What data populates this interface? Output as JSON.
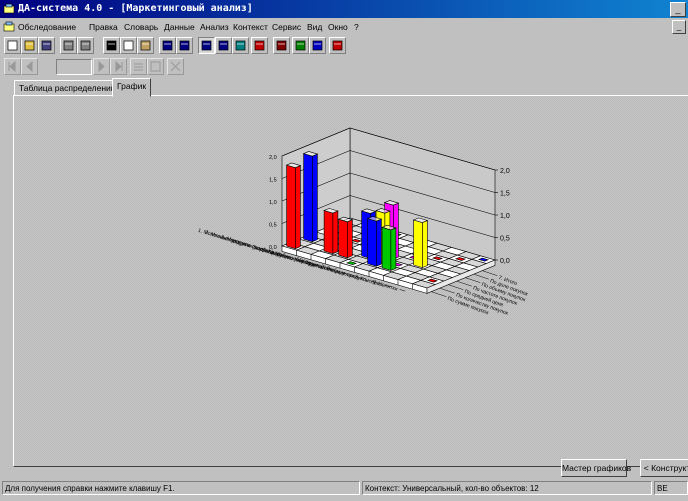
{
  "window": {
    "title": "ДА-система 4.0 - [Маркетинговый анализ]",
    "min_glyph": "_",
    "mdi_min_glyph": "_",
    "mdi_restore_glyph": "▫"
  },
  "menu": [
    "Обследование",
    "Правка",
    "Словарь",
    "Данные",
    "Анализ",
    "Контекст",
    "Сервис",
    "Вид",
    "Окно",
    "?"
  ],
  "toolbar_icons": [
    "new-icon",
    "open-icon",
    "save-icon",
    "print-icon",
    "print-preview-icon",
    "cut-icon",
    "copy-icon",
    "paste-icon",
    "undo-icon",
    "redo-icon",
    "table-icon",
    "grid-icon",
    "refresh-icon",
    "chart-icon",
    "link-icon",
    "excel-icon",
    "word-icon",
    "export-icon"
  ],
  "nav_icons": [
    "first-record-icon",
    "prev-record-icon",
    "next-record-icon",
    "last-record-icon",
    "list-icon",
    "edit-icon",
    "delete-icon"
  ],
  "tabs": [
    "Таблица распределений",
    "График"
  ],
  "buttons": {
    "chart_master": "Мастер графиков",
    "constructor": "< Конструкт"
  },
  "status": {
    "help": "Для получения справки нажмите клавишу F1.",
    "context": "Контекст: Универсальный, кол-во объектов: 12",
    "right": "ВЕ"
  },
  "colors": {
    "red": "#ff0000",
    "blue": "#0000ff",
    "green": "#00c800",
    "yellow": "#ffff00",
    "magenta": "#ff00ff",
    "cyan": "#00ffff"
  },
  "chart_data": {
    "type": "bar",
    "title": "",
    "z_axis_ticks": [
      "2,0",
      "1,5",
      "1,0",
      "0,5",
      "0,0"
    ],
    "left_axis_ticks": [
      "2,0",
      "1,5",
      "1,0",
      "0,5",
      "0,0"
    ],
    "zlim": [
      0,
      2
    ],
    "categories": [
      "1. Молочные продукты (сыр, кефир)",
      "2. Мясные продукты (колбаса, сосиски)",
      "3. Молочные продукты (масло, творог)",
      "4. Хлебобулочные изделия",
      "5. Фрукты, овощи",
      "6. Кондитерские изделия",
      "7. Рыбные продукты",
      "8. Консервы",
      "9. Напитки"
    ],
    "series_labels": [
      "По сумме покупок",
      "По количеству покупок",
      "По средней цене",
      "По частоте покупок",
      "По объему покупок",
      "По доле покупок",
      "7. Итого"
    ],
    "bars": [
      {
        "cat": 0,
        "series": 0,
        "value": 1.8,
        "color": "red"
      },
      {
        "cat": 0,
        "series": 2,
        "value": 1.9,
        "color": "blue"
      },
      {
        "cat": 2,
        "series": 1,
        "value": 0.9,
        "color": "red"
      },
      {
        "cat": 3,
        "series": 1,
        "value": 0.8,
        "color": "red"
      },
      {
        "cat": 4,
        "series": 2,
        "value": 1.0,
        "color": "blue"
      },
      {
        "cat": 5,
        "series": 3,
        "value": 1.2,
        "color": "magenta"
      },
      {
        "cat": 5,
        "series": 2,
        "value": 1.1,
        "color": "yellow"
      },
      {
        "cat": 5,
        "series": 1,
        "value": 1.0,
        "color": "blue"
      },
      {
        "cat": 6,
        "series": 1,
        "value": 0.9,
        "color": "green"
      },
      {
        "cat": 7,
        "series": 3,
        "value": 1.0,
        "color": "yellow"
      }
    ],
    "floor_markers": [
      "green",
      "red",
      "magenta",
      "blue",
      "red",
      "green",
      "red",
      "magenta",
      "green",
      "red",
      "blue",
      "green",
      "magenta",
      "red",
      "green",
      "blue"
    ]
  }
}
